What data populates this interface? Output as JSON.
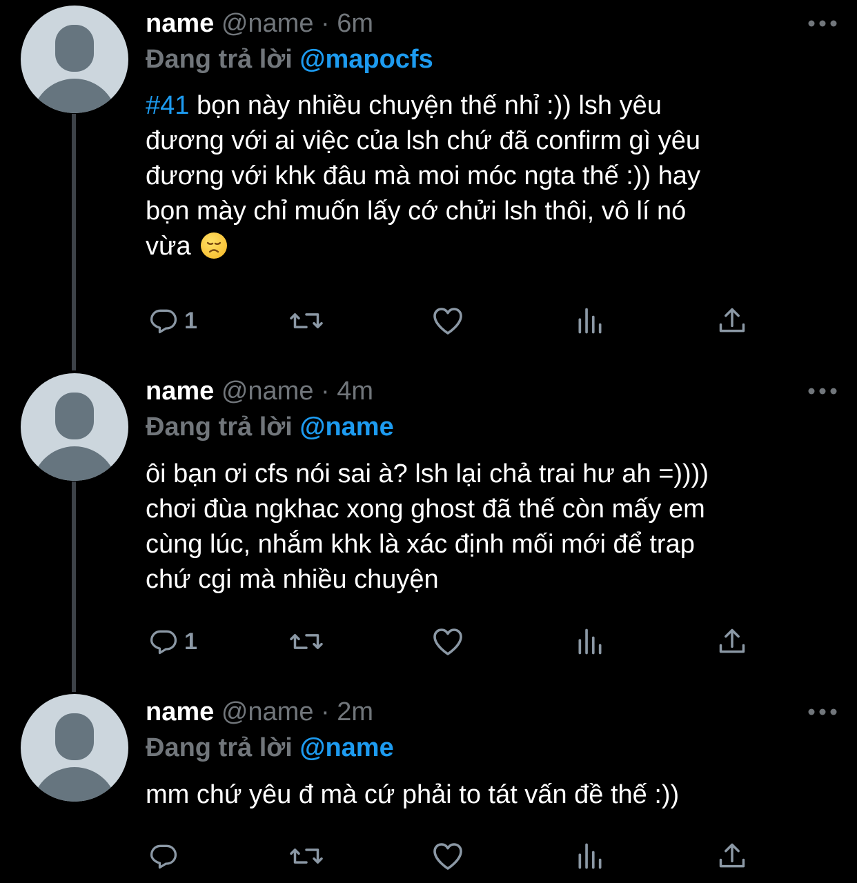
{
  "tweets": [
    {
      "name": "name",
      "handle": "@name",
      "separator": "·",
      "time": "6m",
      "reply_prefix": "Đang trả lời",
      "reply_to": "@mapocfs",
      "hashtag": "#41",
      "text": " bọn này nhiều chuyện thế nhỉ :)) lsh yêu\nđương với ai việc của lsh chứ đã confirm gì yêu\nđương với khk đâu mà moi móc ngta thế :)) hay\nbọn mày chỉ muốn lấy cớ chửi lsh thôi, vô lí nó\nvừa",
      "emoji": "disappointed-face",
      "reply_count": "1"
    },
    {
      "name": "name",
      "handle": "@name",
      "separator": "·",
      "time": "4m",
      "reply_prefix": "Đang trả lời",
      "reply_to": "@name",
      "text": "ôi bạn ơi cfs nói sai à? lsh lại chả trai hư ah =))))\nchơi đùa ngkhac xong ghost đã thế còn mấy em\ncùng lúc, nhắm khk là xác định mối mới để trap\nchứ cgi mà nhiều chuyện",
      "reply_count": "1"
    },
    {
      "name": "name",
      "handle": "@name",
      "separator": "·",
      "time": "2m",
      "reply_prefix": "Đang trả lời",
      "reply_to": "@name",
      "text": "mm chứ yêu đ mà cứ phải to tát vấn đề thế :))",
      "reply_count": ""
    }
  ],
  "icons": {
    "reply": "reply-icon",
    "retweet": "retweet-icon",
    "like": "heart-icon",
    "views": "analytics-icon",
    "share": "share-icon",
    "more": "more-icon"
  },
  "colors": {
    "background": "#000000",
    "accent": "#1d9bf0",
    "secondary": "#71767b",
    "thread_line": "#3d4248"
  }
}
